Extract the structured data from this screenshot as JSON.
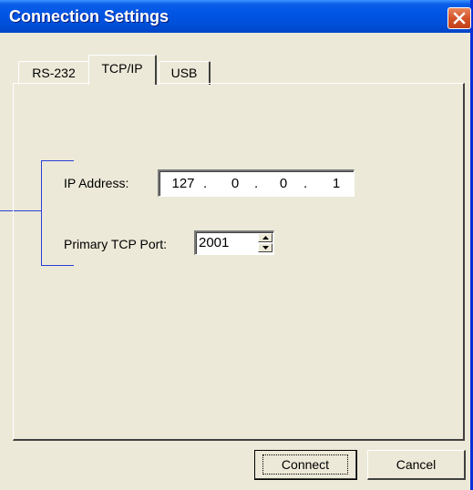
{
  "window": {
    "title": "Connection Settings",
    "close_icon": "close-icon"
  },
  "tabs": [
    {
      "label": "RS-232",
      "selected": false
    },
    {
      "label": "TCP/IP",
      "selected": true
    },
    {
      "label": "USB",
      "selected": false
    }
  ],
  "tcpip": {
    "ip_label": "IP Address:",
    "ip_octets": [
      "127",
      "0",
      "0",
      "1"
    ],
    "ip_separator": ".",
    "port_label": "Primary TCP Port:",
    "port_value": "2001"
  },
  "buttons": {
    "connect": "Connect",
    "cancel": "Cancel"
  },
  "colors": {
    "titlebar": "#0055e5",
    "dialog_bg": "#ece9d8",
    "close_button": "#d4542a",
    "callout_line": "#2a3fd6"
  }
}
